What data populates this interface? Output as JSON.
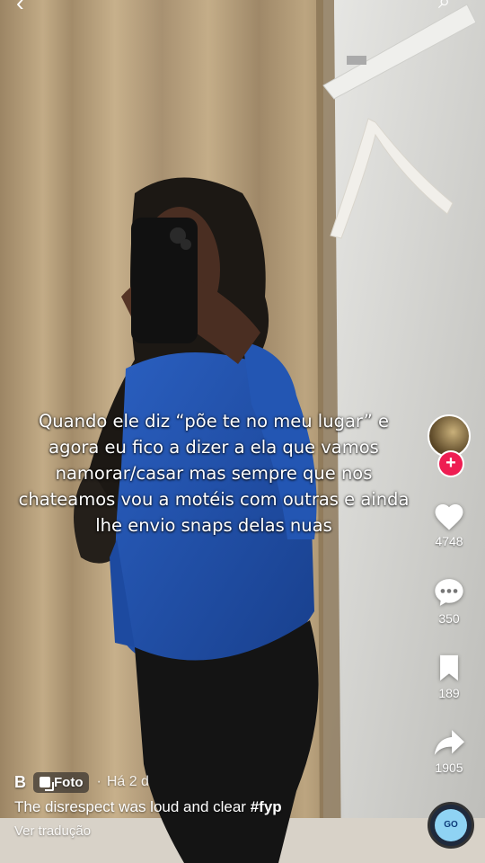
{
  "nav": {
    "back_icon": "chevron-left-icon",
    "search_icon": "search-icon"
  },
  "post": {
    "overlay_text": "Quando ele diz “põe te no meu lugar” e agora eu fico a dizer a ela que vamos namorar/casar mas sempre que nos chateamos vou a motéis com outras e ainda lhe envio snaps delas nuas",
    "author": "B",
    "type_badge": "Foto",
    "separator": "·",
    "time": "Há 2 d",
    "description": "The disrespect was loud and clear",
    "hashtag": "#fyp",
    "translate_label": "Ver tradução"
  },
  "rail": {
    "follow_symbol": "+",
    "likes": "4748",
    "comments": "350",
    "saves": "189",
    "shares": "1905"
  },
  "music": {
    "disc_label": "GO"
  },
  "colors": {
    "follow": "#ee1d52",
    "top_shirt": "#1f4fa8",
    "curtain": "#b19a77",
    "wall": "#d9d9d6"
  }
}
